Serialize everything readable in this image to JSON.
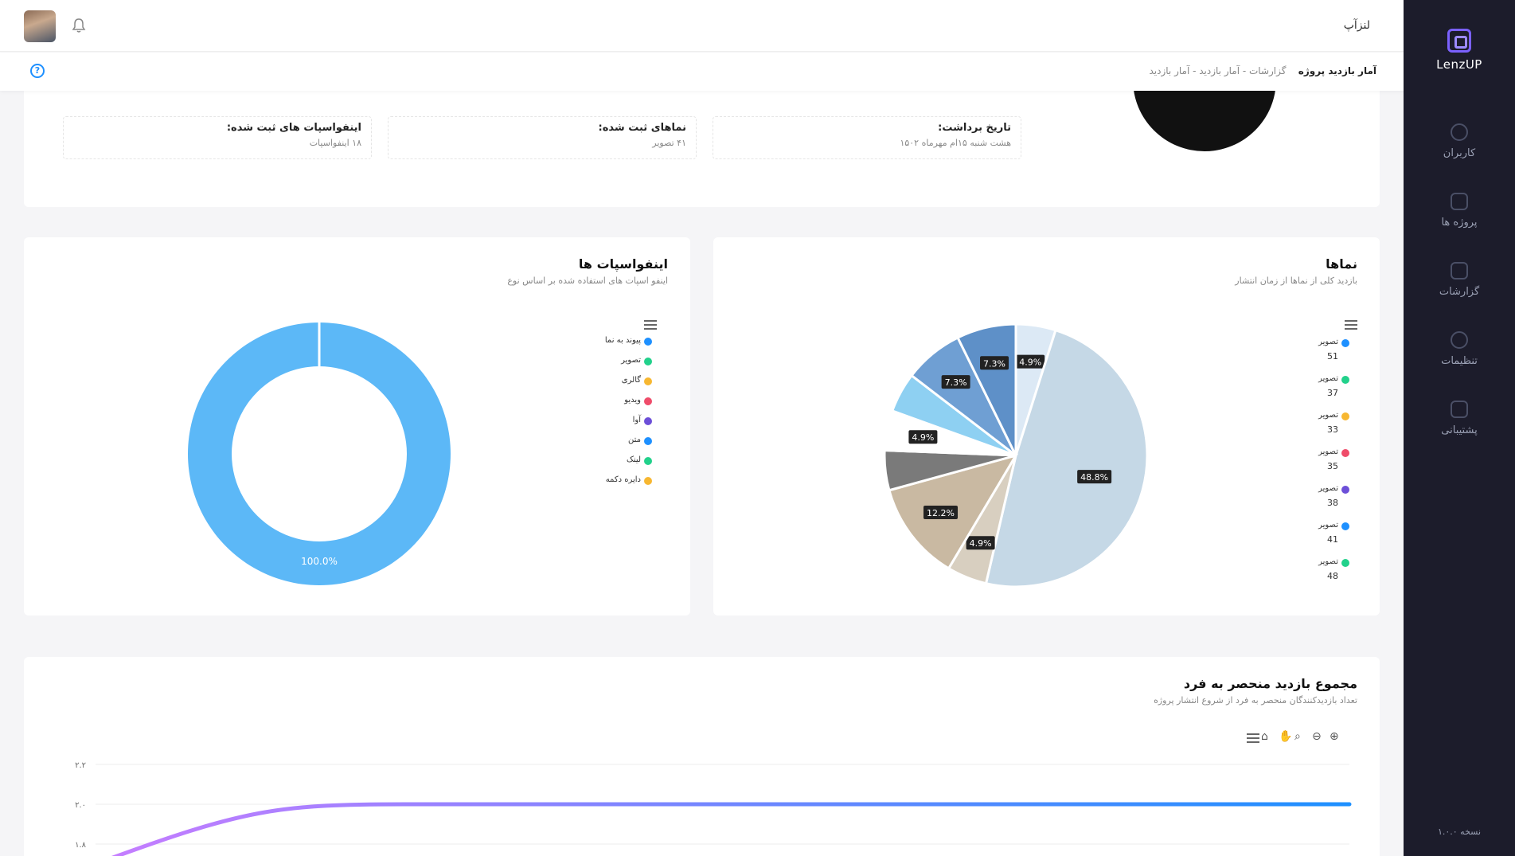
{
  "app": {
    "name": "لنزآپ",
    "logo_text": "LenzUP",
    "version": "نسخه ۱.۰.۰"
  },
  "sidebar": {
    "items": [
      {
        "label": "کاربران",
        "icon": "users-icon"
      },
      {
        "label": "پروژه ها",
        "icon": "layers-icon"
      },
      {
        "label": "گزارشات",
        "icon": "chart-icon"
      },
      {
        "label": "تنظیمات",
        "icon": "gear-icon"
      },
      {
        "label": "پشتیبانی",
        "icon": "support-icon"
      }
    ]
  },
  "breadcrumb": {
    "current": "آمار بازدید پروژه",
    "trail": "گزارشات  -  آمار بازدید  -  آمار بازدید"
  },
  "project": {
    "stats": [
      {
        "title": "تاریخ برداشت:",
        "value": "هشت شنبه ۱۵ام مهرماه ۱۵۰۲"
      },
      {
        "title": "نماهای ثبت شده:",
        "value": "۴۱ تصویر"
      },
      {
        "title": "اینفواسپات های ثبت شده:",
        "value": "۱۸ اینفواسپات"
      }
    ]
  },
  "views_card": {
    "title": "نماها",
    "subtitle": "بازدید کلی از نماها از زمان انتشار",
    "legend": [
      {
        "label": "تصویر",
        "value": "51",
        "color": "#1e90ff"
      },
      {
        "label": "تصویر",
        "value": "37",
        "color": "#22d18b"
      },
      {
        "label": "تصویر",
        "value": "33",
        "color": "#f7b731"
      },
      {
        "label": "تصویر",
        "value": "35",
        "color": "#ef4c6a"
      },
      {
        "label": "تصویر",
        "value": "38",
        "color": "#6c4fd8"
      },
      {
        "label": "تصویر",
        "value": "41",
        "color": "#1e90ff"
      },
      {
        "label": "تصویر",
        "value": "48",
        "color": "#22d18b"
      }
    ]
  },
  "infospots_card": {
    "title": "اینفواسپات ها",
    "subtitle": "اینفو اسپات های استفاده شده بر اساس نوع",
    "legend": [
      {
        "label": "پیوند به نما",
        "color": "#1e90ff"
      },
      {
        "label": "تصویر",
        "color": "#22d18b"
      },
      {
        "label": "گالری",
        "color": "#f7b731"
      },
      {
        "label": "ویدیو",
        "color": "#ef4c6a"
      },
      {
        "label": "آوا",
        "color": "#6c4fd8"
      },
      {
        "label": "متن",
        "color": "#1e90ff"
      },
      {
        "label": "لینک",
        "color": "#22d18b"
      },
      {
        "label": "دایره دکمه",
        "color": "#f7b731"
      }
    ]
  },
  "visitors_card": {
    "title": "مجموع بازدید منحصر به فرد",
    "subtitle": "تعداد بازدیدکنندگان منحصر به فرد از شروع انتشار پروژه"
  },
  "chart_data": [
    {
      "type": "pie",
      "title": "نماها",
      "slices": [
        {
          "value": 4.9,
          "label": "4.9%",
          "color": "#dce9f5"
        },
        {
          "value": 48.8,
          "label": "48.8%",
          "color": "#c5d8e6"
        },
        {
          "value": 4.9,
          "label": "4.9%",
          "color": "#d8cfc0"
        },
        {
          "value": 12.2,
          "label": "12.2%",
          "color": "#c9b9a2"
        },
        {
          "value": 4.9,
          "label": "",
          "color": "#7a7a7a"
        },
        {
          "value": 4.9,
          "label": "4.9%",
          "color": "#ffffff"
        },
        {
          "value": 4.9,
          "label": "",
          "color": "#8ed0f2"
        },
        {
          "value": 7.3,
          "label": "7.3%",
          "color": "#6f9fd3"
        },
        {
          "value": 7.3,
          "label": "7.3%",
          "color": "#5e90c8"
        }
      ]
    },
    {
      "type": "pie",
      "title": "اینفواسپات ها",
      "donut": true,
      "slices": [
        {
          "value": 100.0,
          "label": "100.0%",
          "color": "#5cb8f7"
        }
      ]
    },
    {
      "type": "line",
      "title": "مجموع بازدید منحصر به فرد",
      "ytick_labels": [
        "۲.۲",
        "۲.۰",
        "۱.۸"
      ],
      "ylim": [
        1.7,
        2.2
      ],
      "series": [
        {
          "x": [
            0,
            0.12,
            0.25,
            1.0
          ],
          "values": [
            1.7,
            1.9,
            2.0,
            2.0
          ]
        }
      ],
      "grid": true
    }
  ]
}
